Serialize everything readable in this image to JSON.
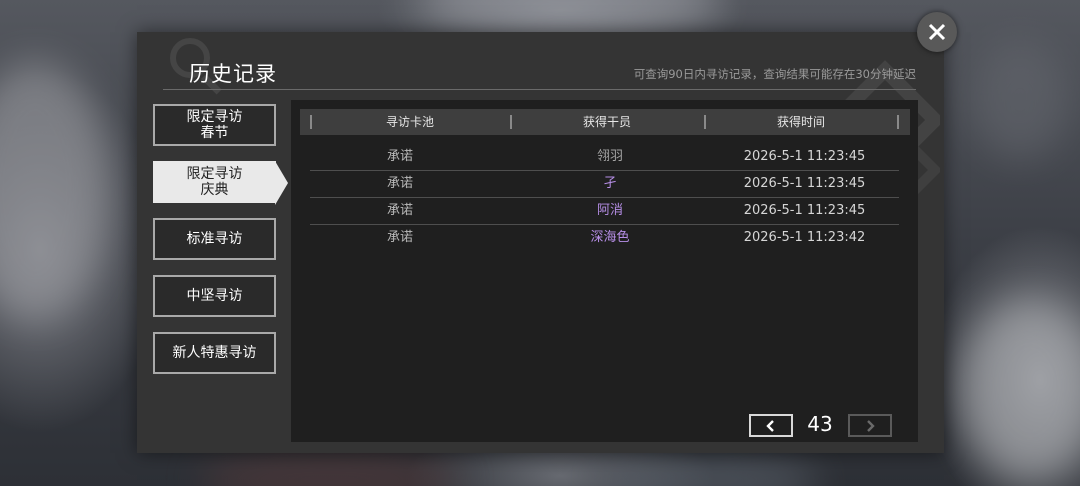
{
  "title": "历史记录",
  "notice": "可查询90日内寻访记录，查询结果可能存在30分钟延迟",
  "tabs": [
    {
      "line1": "限定寻访",
      "line2": "春节",
      "active": false
    },
    {
      "line1": "限定寻访",
      "line2": "庆典",
      "active": true
    },
    {
      "line1": "标准寻访",
      "line2": "",
      "active": false
    },
    {
      "line1": "中坚寻访",
      "line2": "",
      "active": false
    },
    {
      "line1": "新人特惠寻访",
      "line2": "",
      "active": false
    }
  ],
  "table": {
    "headers": [
      "寻访卡池",
      "获得干员",
      "获得时间"
    ],
    "rows": [
      {
        "pool": "承诺",
        "operator": "翎羽",
        "time": "2026-5-1 11:23:45",
        "rarity_color": "#a3a3a3"
      },
      {
        "pool": "承诺",
        "operator": "孑",
        "time": "2026-5-1 11:23:45",
        "rarity_color": "#b68ee6"
      },
      {
        "pool": "承诺",
        "operator": "阿消",
        "time": "2026-5-1 11:23:45",
        "rarity_color": "#b68ee6"
      },
      {
        "pool": "承诺",
        "operator": "深海色",
        "time": "2026-5-1 11:23:42",
        "rarity_color": "#b68ee6"
      }
    ]
  },
  "pagination": {
    "current_page": "43",
    "prev_icon": "chevron-left-icon",
    "next_icon": "chevron-right-icon"
  },
  "close_icon": "close-icon"
}
